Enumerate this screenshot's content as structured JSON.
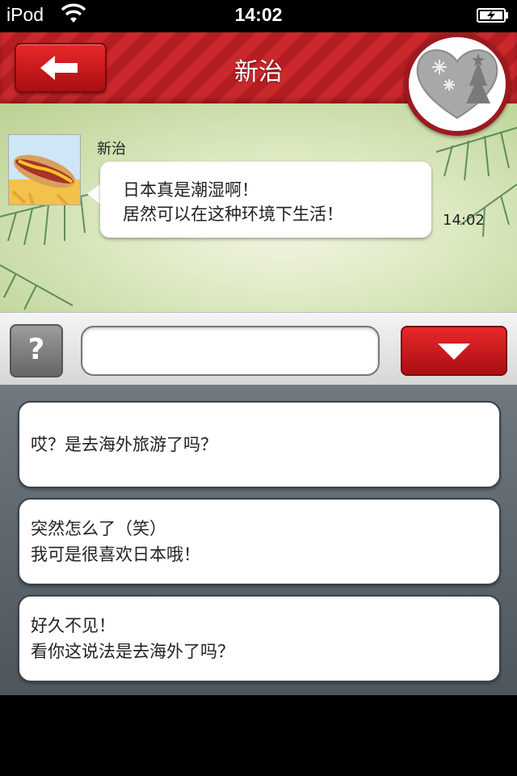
{
  "status_bar": {
    "carrier": "iPod",
    "time": "14:02"
  },
  "header": {
    "title": "新治",
    "back_icon": "back-arrow-icon",
    "badge_icon": "heart-christmas-icon"
  },
  "chat": {
    "sender_name": "新治",
    "message": "日本真是潮湿啊！\n居然可以在这种环境下生活！",
    "time": "14:02"
  },
  "input_bar": {
    "help_label": "?",
    "input_value": "",
    "toggle_icon": "chevron-down-icon"
  },
  "options": [
    {
      "text": "哎？是去海外旅游了吗？"
    },
    {
      "text": "突然怎么了（笑）\n我可是很喜欢日本哦！"
    },
    {
      "text": "好久不见！\n看你这说法是去海外了吗？"
    }
  ],
  "colors": {
    "header_red": "#c9282c",
    "button_red": "#d01a1e",
    "panel_gray": "#5f676e"
  }
}
